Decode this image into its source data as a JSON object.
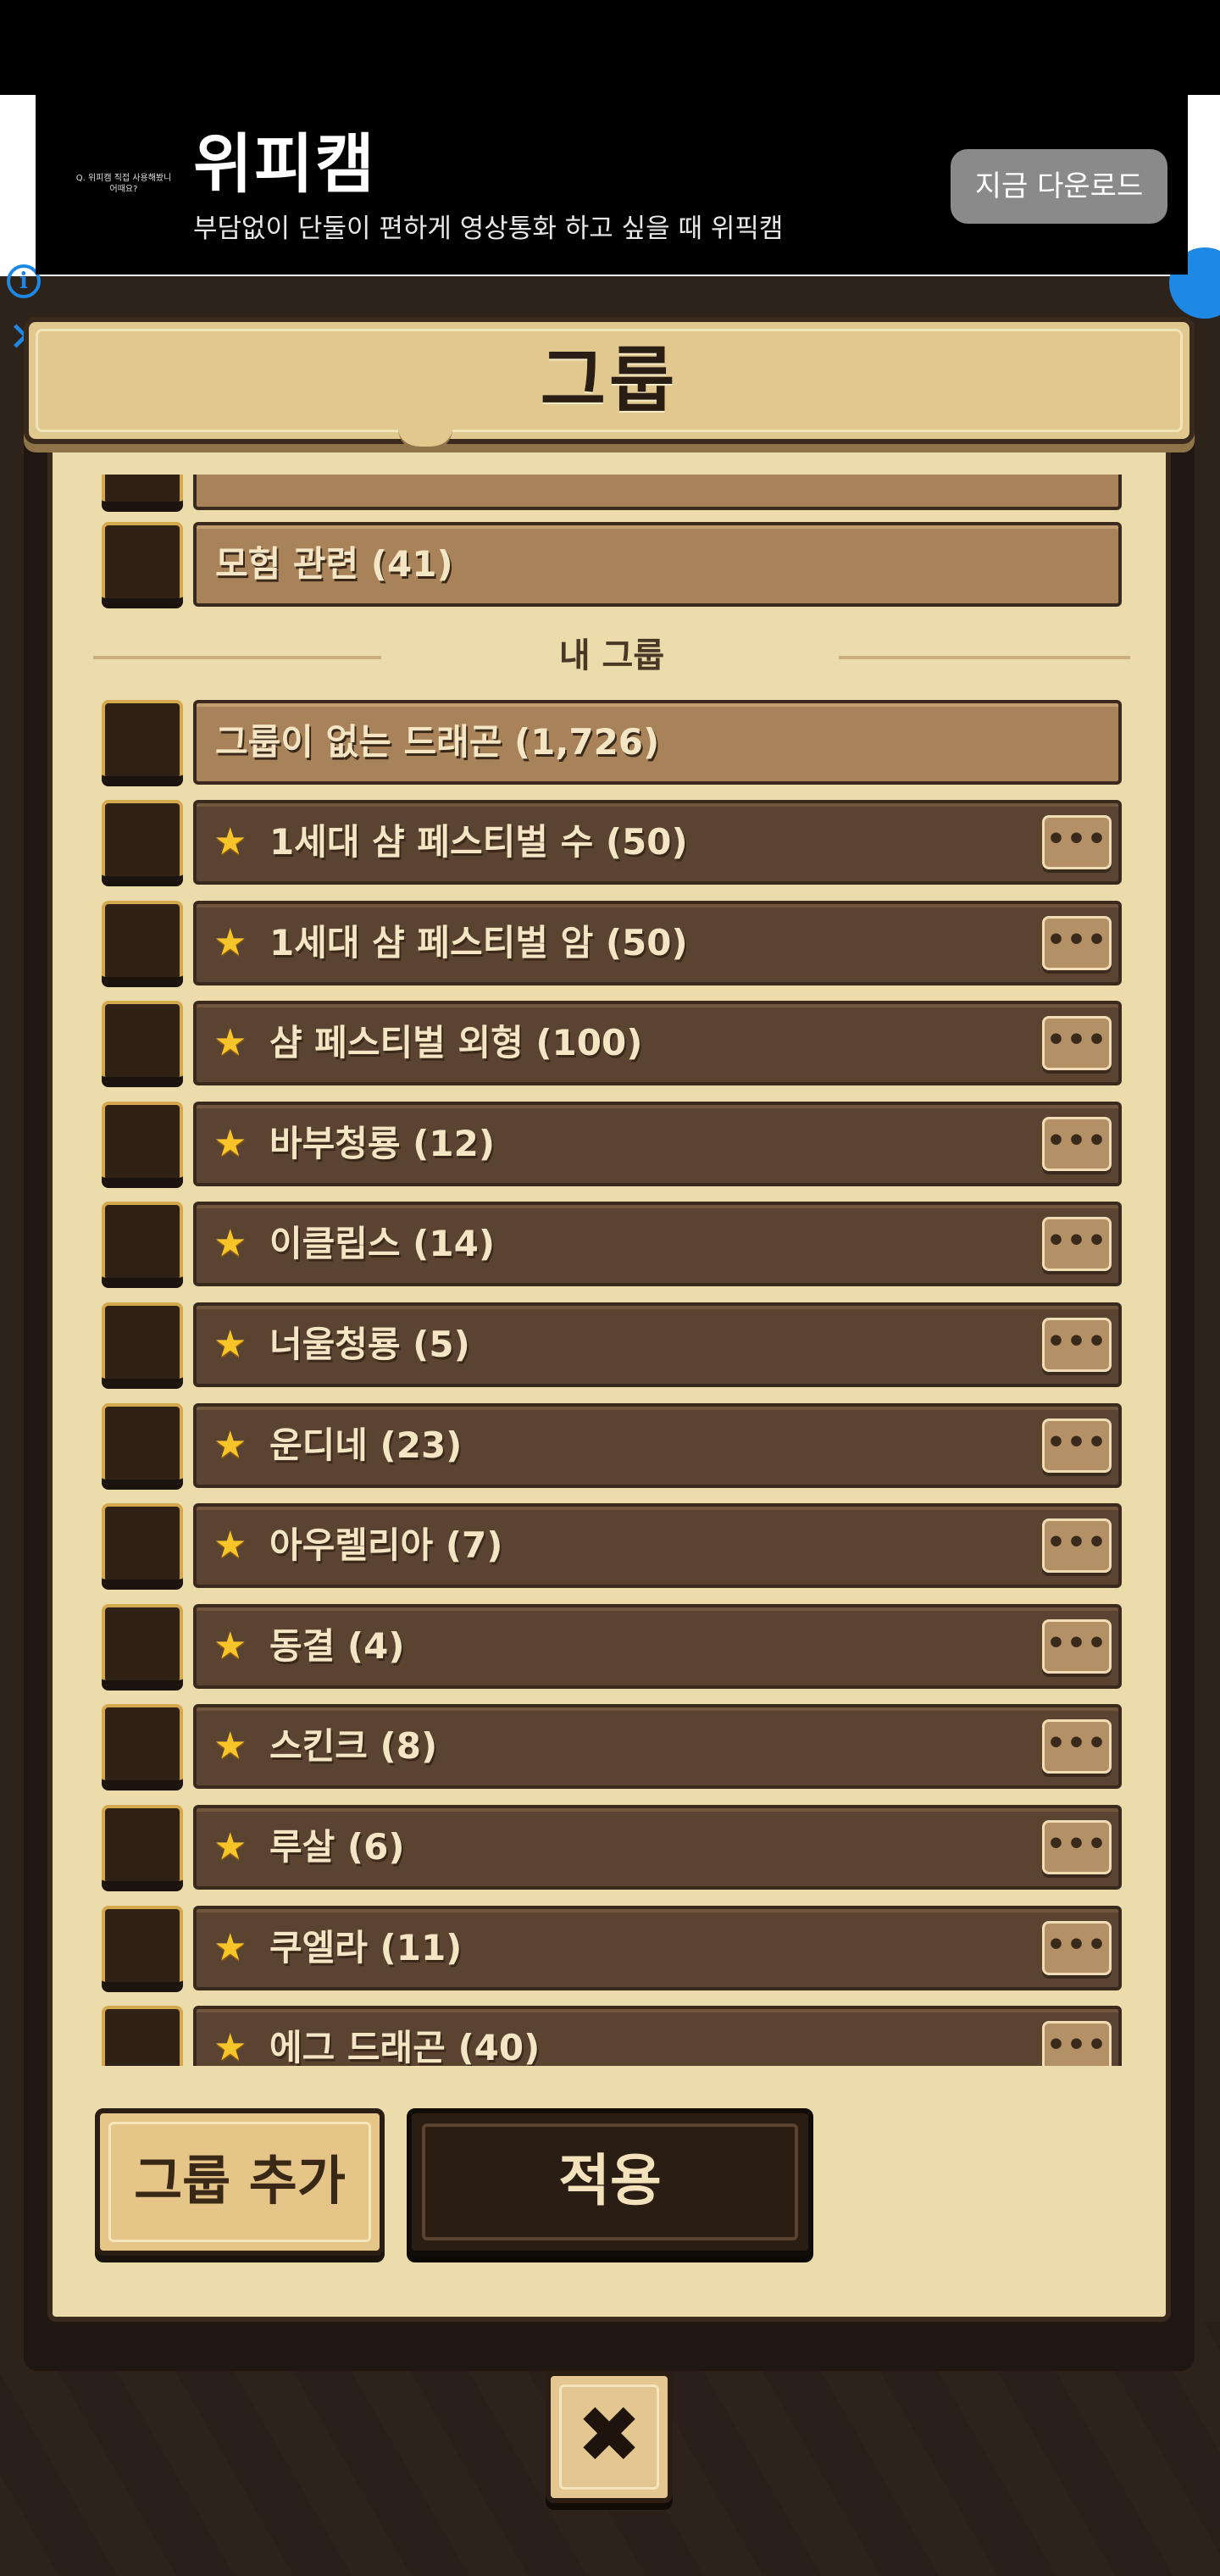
{
  "ad": {
    "logo_text": "Q. 위피캠 직접 사용해봤니 어때요?",
    "title": "위피캠",
    "description": "부담없이 단둘이 편하게 영상통화 하고 싶을 때 위픽캠",
    "cta_label": "지금 다운로드",
    "info_icon": "i",
    "close_icon": "✕"
  },
  "dialog": {
    "title": "그룹",
    "section_label": "내 그룹",
    "partial_top_label": "",
    "adventure_row": "모험 관련 (41)",
    "ungrouped_row": "그룹이 없는 드래곤 (1,726)",
    "groups": [
      {
        "label": "1세대 샴 페스티벌 수 (50)",
        "starred": true
      },
      {
        "label": "1세대 샴 페스티벌 암 (50)",
        "starred": true
      },
      {
        "label": "샴 페스티벌 외형 (100)",
        "starred": true
      },
      {
        "label": "바부청룡 (12)",
        "starred": true
      },
      {
        "label": "이클립스 (14)",
        "starred": true
      },
      {
        "label": "너울청룡 (5)",
        "starred": true
      },
      {
        "label": "운디네 (23)",
        "starred": true
      },
      {
        "label": "아우렐리아 (7)",
        "starred": true
      },
      {
        "label": "동결 (4)",
        "starred": true
      },
      {
        "label": "스킨크 (8)",
        "starred": true
      },
      {
        "label": "루살 (6)",
        "starred": true
      },
      {
        "label": "쿠엘라 (11)",
        "starred": true
      },
      {
        "label": "에그 드래곤 (40)",
        "starred": true
      }
    ],
    "more_button_label": "•••",
    "star_icon": "★",
    "add_group_label": "그룹 추가",
    "apply_label": "적용",
    "close_icon": "✖"
  },
  "colors": {
    "background": "#2e231b",
    "panel": "#ecdcab",
    "row_light": "#a88259",
    "row_dark": "#5b4331",
    "star": "#f7c52a",
    "ad_accent": "#1e88e5"
  }
}
